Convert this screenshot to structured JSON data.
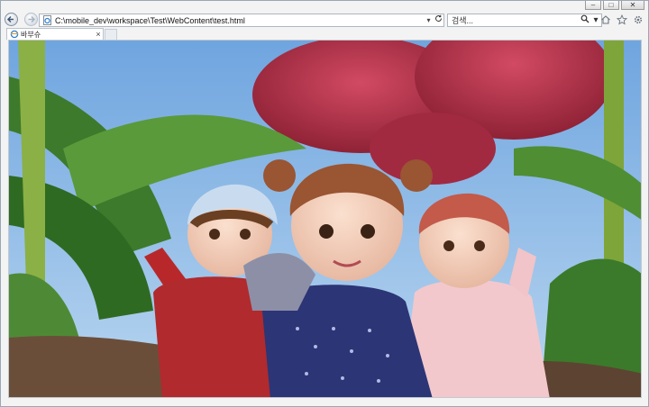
{
  "browser": {
    "address": "C:\\mobile_dev\\workspace\\Test\\WebContent\\test.html",
    "search_placeholder": "검색...",
    "tab_title": "바부슈",
    "tab_close": "×",
    "caption_buttons": {
      "minimize": "–",
      "maximize": "□",
      "close": "✕"
    }
  },
  "icons": {
    "back": "back-arrow-icon",
    "forward": "forward-arrow-icon",
    "page": "ie-page-icon",
    "address_dropdown": "chevron-down-icon",
    "refresh": "refresh-icon",
    "search": "search-icon",
    "home": "home-icon",
    "favorites": "star-icon",
    "tools": "gear-icon"
  },
  "content": {
    "image_subject": "three animated dolls saluting in a garden",
    "colors": {
      "sky": "#7fb2e4",
      "leaf": "#3f7f2a",
      "flower": "#c0304a",
      "ground": "#6b4e3a"
    }
  }
}
